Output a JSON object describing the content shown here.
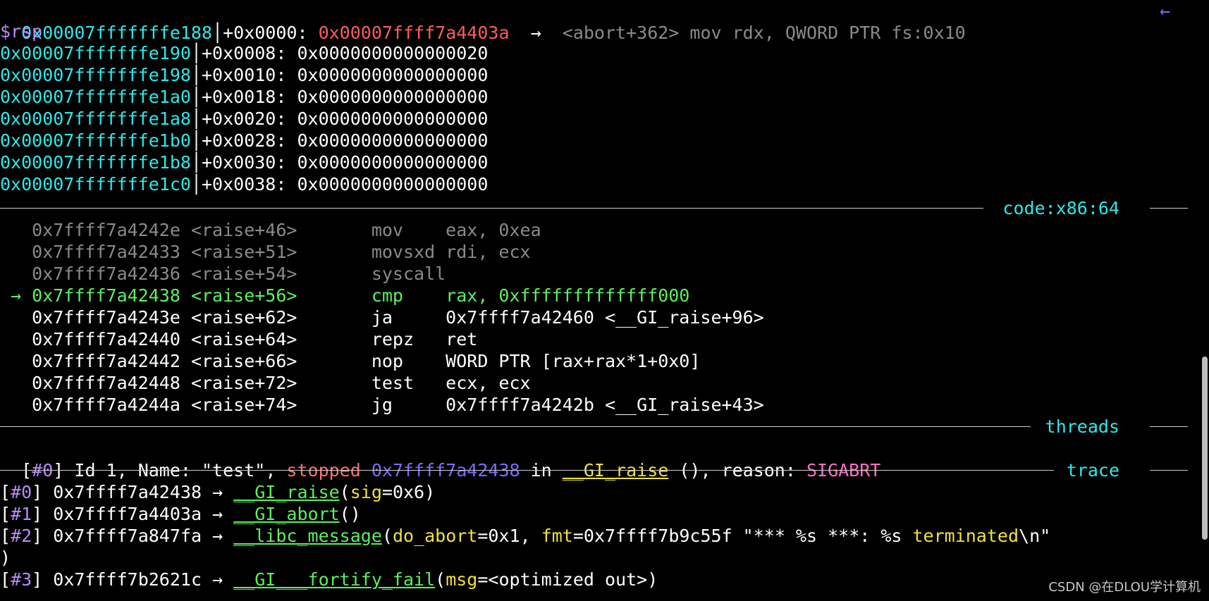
{
  "colors": {
    "address": "#2ee8e8",
    "register": "#b88af4",
    "red_value": "#ff5c5c",
    "dim": "#8a8a8a",
    "current": "#5cf05c",
    "frame": "#b88af4",
    "func": "#5cf05c",
    "arg": "#f0e040",
    "thread_addr": "#7a6cff",
    "stopped": "#ff7070",
    "signal": "#ff6ec7",
    "section": "#2ee8e8"
  },
  "stack": {
    "first": {
      "addr": "0x00007fffffffe188",
      "offset": "+0x0000: ",
      "value": "0x00007ffff7a4403a",
      "arrow": "  →  ",
      "annotation": "<abort+362> mov rdx, QWORD PTR fs:0x10",
      "back_arrow": "←",
      "register": "$rsp"
    },
    "rows": [
      {
        "addr": "0x00007fffffffe190",
        "offset": "+0x0008: ",
        "value": "0x0000000000000020"
      },
      {
        "addr": "0x00007fffffffe198",
        "offset": "+0x0010: ",
        "value": "0x0000000000000000"
      },
      {
        "addr": "0x00007fffffffe1a0",
        "offset": "+0x0018: ",
        "value": "0x0000000000000000"
      },
      {
        "addr": "0x00007fffffffe1a8",
        "offset": "+0x0020: ",
        "value": "0x0000000000000000"
      },
      {
        "addr": "0x00007fffffffe1b0",
        "offset": "+0x0028: ",
        "value": "0x0000000000000000"
      },
      {
        "addr": "0x00007fffffffe1b8",
        "offset": "+0x0030: ",
        "value": "0x0000000000000000"
      },
      {
        "addr": "0x00007fffffffe1c0",
        "offset": "+0x0038: ",
        "value": "0x0000000000000000"
      }
    ]
  },
  "code": {
    "title": "code:x86:64",
    "rows": [
      {
        "marker": "   ",
        "addr": "0x7ffff7a4242e",
        "sym": "<raise+46>",
        "mnem": "mov",
        "ops": "eax, 0xea",
        "state": "past"
      },
      {
        "marker": "   ",
        "addr": "0x7ffff7a42433",
        "sym": "<raise+51>",
        "mnem": "movsxd",
        "ops": "rdi, ecx",
        "state": "past"
      },
      {
        "marker": "   ",
        "addr": "0x7ffff7a42436",
        "sym": "<raise+54>",
        "mnem": "syscall",
        "ops": "",
        "state": "past"
      },
      {
        "marker": " → ",
        "addr": "0x7ffff7a42438",
        "sym": "<raise+56>",
        "mnem": "cmp",
        "ops": "rax, 0xfffffffffffff000",
        "state": "current"
      },
      {
        "marker": "   ",
        "addr": "0x7ffff7a4243e",
        "sym": "<raise+62>",
        "mnem": "ja",
        "ops": "0x7ffff7a42460 <__GI_raise+96>",
        "state": "next"
      },
      {
        "marker": "   ",
        "addr": "0x7ffff7a42440",
        "sym": "<raise+64>",
        "mnem": "repz",
        "ops": "ret",
        "state": "next"
      },
      {
        "marker": "   ",
        "addr": "0x7ffff7a42442",
        "sym": "<raise+66>",
        "mnem": "nop",
        "ops": "WORD PTR [rax+rax*1+0x0]",
        "state": "next"
      },
      {
        "marker": "   ",
        "addr": "0x7ffff7a42448",
        "sym": "<raise+72>",
        "mnem": "test",
        "ops": "ecx, ecx",
        "state": "next"
      },
      {
        "marker": "   ",
        "addr": "0x7ffff7a4244a",
        "sym": "<raise+74>",
        "mnem": "jg",
        "ops": "0x7ffff7a4242b <__GI_raise+43>",
        "state": "next"
      }
    ]
  },
  "threads": {
    "title": "threads",
    "line": {
      "open": "[",
      "id": "#0",
      "close": "] ",
      "text1": "Id 1, Name: \"test\", ",
      "stopped": "stopped",
      "space": " ",
      "addr": "0x7ffff7a42438",
      "in": " in ",
      "func": "__GI_raise",
      "reason_label": " (), reason: ",
      "signal": "SIGABRT"
    }
  },
  "trace": {
    "title": "trace",
    "frames": [
      {
        "id": "#0",
        "addr": "0x7ffff7a42438",
        "func": "__GI_raise",
        "open": "(",
        "args": [
          {
            "name": "sig",
            "eq": "=",
            "val": "0x6"
          }
        ],
        "close": ")"
      },
      {
        "id": "#1",
        "addr": "0x7ffff7a4403a",
        "func": "__GI_abort",
        "open": "(",
        "args": [],
        "close": ")"
      },
      {
        "id": "#2",
        "addr": "0x7ffff7a847fa",
        "func": "__libc_message",
        "open": "(",
        "args": [
          {
            "name": "do_abort",
            "eq": "=",
            "val": "0x1"
          },
          {
            "name": "fmt",
            "eq": "=",
            "val": "0x7ffff7b9c55f \"*** %s ***: %s "
          }
        ],
        "tail_yellow": "terminated",
        "tail_white": "\\n\"",
        "close": ")"
      },
      {
        "id": "#3",
        "addr": "0x7ffff7b2621c",
        "func": "__GI___fortify_fail",
        "open": "(",
        "args": [
          {
            "name": "msg",
            "eq": "=",
            "val": "<optimized out>"
          }
        ],
        "close": ")"
      }
    ],
    "arrow": " → ",
    "wrap_close": ")"
  },
  "watermark": "CSDN @在DLOU学计算机"
}
